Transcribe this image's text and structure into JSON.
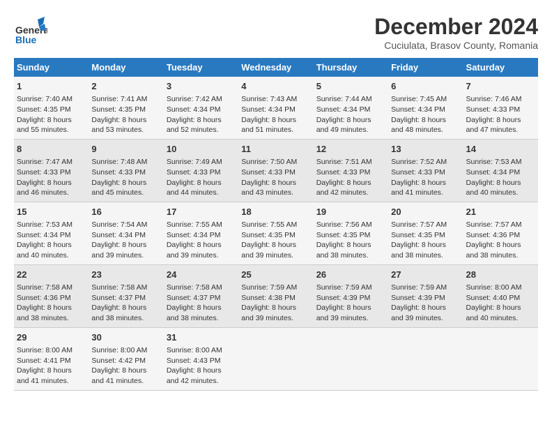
{
  "header": {
    "logo_line1": "General",
    "logo_line2": "Blue",
    "title": "December 2024",
    "subtitle": "Cuciulata, Brasov County, Romania"
  },
  "columns": [
    "Sunday",
    "Monday",
    "Tuesday",
    "Wednesday",
    "Thursday",
    "Friday",
    "Saturday"
  ],
  "weeks": [
    [
      {
        "day": "1",
        "lines": [
          "Sunrise: 7:40 AM",
          "Sunset: 4:35 PM",
          "Daylight: 8 hours",
          "and 55 minutes."
        ]
      },
      {
        "day": "2",
        "lines": [
          "Sunrise: 7:41 AM",
          "Sunset: 4:35 PM",
          "Daylight: 8 hours",
          "and 53 minutes."
        ]
      },
      {
        "day": "3",
        "lines": [
          "Sunrise: 7:42 AM",
          "Sunset: 4:34 PM",
          "Daylight: 8 hours",
          "and 52 minutes."
        ]
      },
      {
        "day": "4",
        "lines": [
          "Sunrise: 7:43 AM",
          "Sunset: 4:34 PM",
          "Daylight: 8 hours",
          "and 51 minutes."
        ]
      },
      {
        "day": "5",
        "lines": [
          "Sunrise: 7:44 AM",
          "Sunset: 4:34 PM",
          "Daylight: 8 hours",
          "and 49 minutes."
        ]
      },
      {
        "day": "6",
        "lines": [
          "Sunrise: 7:45 AM",
          "Sunset: 4:34 PM",
          "Daylight: 8 hours",
          "and 48 minutes."
        ]
      },
      {
        "day": "7",
        "lines": [
          "Sunrise: 7:46 AM",
          "Sunset: 4:33 PM",
          "Daylight: 8 hours",
          "and 47 minutes."
        ]
      }
    ],
    [
      {
        "day": "8",
        "lines": [
          "Sunrise: 7:47 AM",
          "Sunset: 4:33 PM",
          "Daylight: 8 hours",
          "and 46 minutes."
        ]
      },
      {
        "day": "9",
        "lines": [
          "Sunrise: 7:48 AM",
          "Sunset: 4:33 PM",
          "Daylight: 8 hours",
          "and 45 minutes."
        ]
      },
      {
        "day": "10",
        "lines": [
          "Sunrise: 7:49 AM",
          "Sunset: 4:33 PM",
          "Daylight: 8 hours",
          "and 44 minutes."
        ]
      },
      {
        "day": "11",
        "lines": [
          "Sunrise: 7:50 AM",
          "Sunset: 4:33 PM",
          "Daylight: 8 hours",
          "and 43 minutes."
        ]
      },
      {
        "day": "12",
        "lines": [
          "Sunrise: 7:51 AM",
          "Sunset: 4:33 PM",
          "Daylight: 8 hours",
          "and 42 minutes."
        ]
      },
      {
        "day": "13",
        "lines": [
          "Sunrise: 7:52 AM",
          "Sunset: 4:33 PM",
          "Daylight: 8 hours",
          "and 41 minutes."
        ]
      },
      {
        "day": "14",
        "lines": [
          "Sunrise: 7:53 AM",
          "Sunset: 4:34 PM",
          "Daylight: 8 hours",
          "and 40 minutes."
        ]
      }
    ],
    [
      {
        "day": "15",
        "lines": [
          "Sunrise: 7:53 AM",
          "Sunset: 4:34 PM",
          "Daylight: 8 hours",
          "and 40 minutes."
        ]
      },
      {
        "day": "16",
        "lines": [
          "Sunrise: 7:54 AM",
          "Sunset: 4:34 PM",
          "Daylight: 8 hours",
          "and 39 minutes."
        ]
      },
      {
        "day": "17",
        "lines": [
          "Sunrise: 7:55 AM",
          "Sunset: 4:34 PM",
          "Daylight: 8 hours",
          "and 39 minutes."
        ]
      },
      {
        "day": "18",
        "lines": [
          "Sunrise: 7:55 AM",
          "Sunset: 4:35 PM",
          "Daylight: 8 hours",
          "and 39 minutes."
        ]
      },
      {
        "day": "19",
        "lines": [
          "Sunrise: 7:56 AM",
          "Sunset: 4:35 PM",
          "Daylight: 8 hours",
          "and 38 minutes."
        ]
      },
      {
        "day": "20",
        "lines": [
          "Sunrise: 7:57 AM",
          "Sunset: 4:35 PM",
          "Daylight: 8 hours",
          "and 38 minutes."
        ]
      },
      {
        "day": "21",
        "lines": [
          "Sunrise: 7:57 AM",
          "Sunset: 4:36 PM",
          "Daylight: 8 hours",
          "and 38 minutes."
        ]
      }
    ],
    [
      {
        "day": "22",
        "lines": [
          "Sunrise: 7:58 AM",
          "Sunset: 4:36 PM",
          "Daylight: 8 hours",
          "and 38 minutes."
        ]
      },
      {
        "day": "23",
        "lines": [
          "Sunrise: 7:58 AM",
          "Sunset: 4:37 PM",
          "Daylight: 8 hours",
          "and 38 minutes."
        ]
      },
      {
        "day": "24",
        "lines": [
          "Sunrise: 7:58 AM",
          "Sunset: 4:37 PM",
          "Daylight: 8 hours",
          "and 38 minutes."
        ]
      },
      {
        "day": "25",
        "lines": [
          "Sunrise: 7:59 AM",
          "Sunset: 4:38 PM",
          "Daylight: 8 hours",
          "and 39 minutes."
        ]
      },
      {
        "day": "26",
        "lines": [
          "Sunrise: 7:59 AM",
          "Sunset: 4:39 PM",
          "Daylight: 8 hours",
          "and 39 minutes."
        ]
      },
      {
        "day": "27",
        "lines": [
          "Sunrise: 7:59 AM",
          "Sunset: 4:39 PM",
          "Daylight: 8 hours",
          "and 39 minutes."
        ]
      },
      {
        "day": "28",
        "lines": [
          "Sunrise: 8:00 AM",
          "Sunset: 4:40 PM",
          "Daylight: 8 hours",
          "and 40 minutes."
        ]
      }
    ],
    [
      {
        "day": "29",
        "lines": [
          "Sunrise: 8:00 AM",
          "Sunset: 4:41 PM",
          "Daylight: 8 hours",
          "and 41 minutes."
        ]
      },
      {
        "day": "30",
        "lines": [
          "Sunrise: 8:00 AM",
          "Sunset: 4:42 PM",
          "Daylight: 8 hours",
          "and 41 minutes."
        ]
      },
      {
        "day": "31",
        "lines": [
          "Sunrise: 8:00 AM",
          "Sunset: 4:43 PM",
          "Daylight: 8 hours",
          "and 42 minutes."
        ]
      },
      {
        "day": "",
        "lines": []
      },
      {
        "day": "",
        "lines": []
      },
      {
        "day": "",
        "lines": []
      },
      {
        "day": "",
        "lines": []
      }
    ]
  ]
}
